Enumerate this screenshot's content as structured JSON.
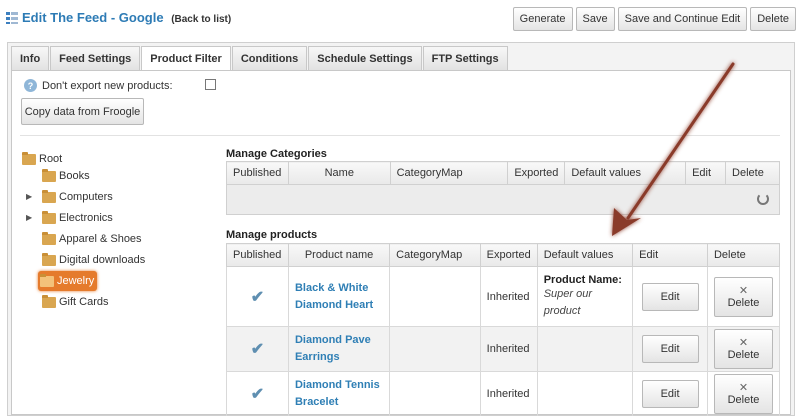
{
  "header": {
    "title": "Edit The Feed - Google",
    "back_link": "(Back to list)",
    "buttons": {
      "generate": "Generate",
      "save": "Save",
      "save_continue": "Save and Continue Edit",
      "delete": "Delete"
    }
  },
  "tabs": [
    "Info",
    "Feed Settings",
    "Product Filter",
    "Conditions",
    "Schedule Settings",
    "FTP Settings"
  ],
  "active_tab": "Product Filter",
  "filter": {
    "dont_export_label": "Don't export new products:",
    "dont_export_checked": false,
    "copy_button": "Copy data from Froogle"
  },
  "tree": {
    "root": "Root",
    "items": [
      "Books",
      "Computers",
      "Electronics",
      "Apparel & Shoes",
      "Digital downloads",
      "Jewelry",
      "Gift Cards"
    ],
    "expandable": [
      "Computers",
      "Electronics"
    ],
    "selected": "Jewelry"
  },
  "categories": {
    "title": "Manage Categories",
    "columns": [
      "Published",
      "Name",
      "CategoryMap",
      "Exported",
      "Default values",
      "Edit",
      "Delete"
    ]
  },
  "products": {
    "title": "Manage products",
    "columns": [
      "Published",
      "Product name",
      "CategoryMap",
      "Exported",
      "Default values",
      "Edit",
      "Delete"
    ],
    "rows": [
      {
        "published": "✔",
        "name_line1": "Black & White",
        "name_line2": "Diamond Heart",
        "category_map": "",
        "exported": "Inherited",
        "default_label": "Product Name:",
        "default_value_line1": "Super our",
        "default_value_line2": "product",
        "edit": "Edit",
        "delete_icon": "✕",
        "delete": "Delete"
      },
      {
        "published": "✔",
        "name_line1": "Diamond Pave",
        "name_line2": "Earrings",
        "category_map": "",
        "exported": "Inherited",
        "default_label": "",
        "default_value_line1": "",
        "default_value_line2": "",
        "edit": "Edit",
        "delete_icon": "✕",
        "delete": "Delete"
      },
      {
        "published": "✔",
        "name_line1": "Diamond Tennis",
        "name_line2": "Bracelet",
        "category_map": "",
        "exported": "Inherited",
        "default_label": "",
        "default_value_line1": "",
        "default_value_line2": "",
        "edit": "Edit",
        "delete_icon": "✕",
        "delete": "Delete"
      }
    ]
  },
  "colors": {
    "title_blue": "#2d7bb5",
    "product_link": "#2f7fb5",
    "selected_folder": "#e57b2c",
    "arrow": "#8a3a2a"
  }
}
